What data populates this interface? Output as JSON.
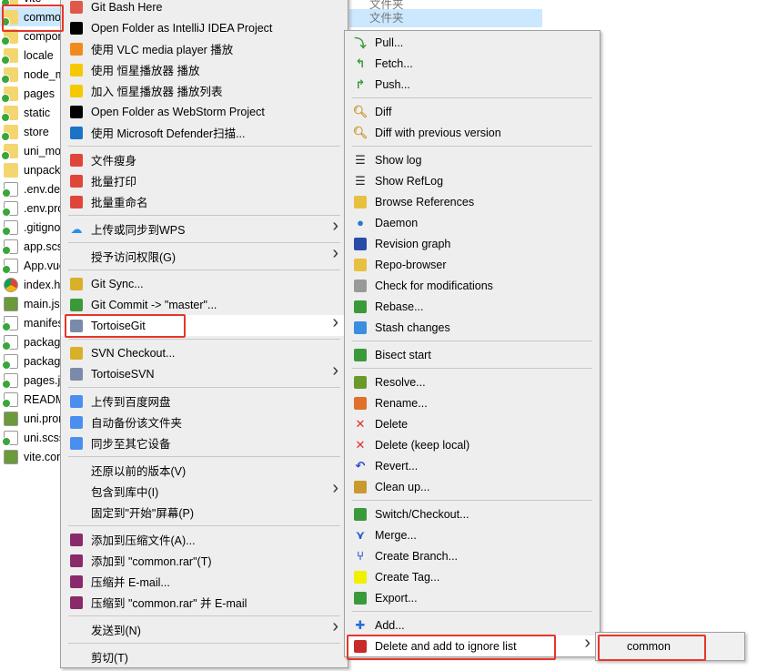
{
  "explorer": {
    "files": [
      {
        "name": "vite",
        "type": "folder"
      },
      {
        "name": "common",
        "type": "folder",
        "selected": true
      },
      {
        "name": "components",
        "type": "folder"
      },
      {
        "name": "locale",
        "type": "folder"
      },
      {
        "name": "node_modules",
        "type": "folder"
      },
      {
        "name": "pages",
        "type": "folder"
      },
      {
        "name": "static",
        "type": "folder"
      },
      {
        "name": "store",
        "type": "folder"
      },
      {
        "name": "uni_modules",
        "type": "folder"
      },
      {
        "name": "unpackage",
        "type": "folder-plain"
      },
      {
        "name": ".env.dev",
        "type": "doc"
      },
      {
        "name": ".env.prod",
        "type": "doc"
      },
      {
        "name": ".gitignore",
        "type": "doc"
      },
      {
        "name": "app.scss",
        "type": "doc"
      },
      {
        "name": "App.vue",
        "type": "doc"
      },
      {
        "name": "index.html",
        "type": "chrome"
      },
      {
        "name": "main.js",
        "type": "script"
      },
      {
        "name": "manifest",
        "type": "doc"
      },
      {
        "name": "package",
        "type": "doc"
      },
      {
        "name": "package",
        "type": "doc"
      },
      {
        "name": "pages.json",
        "type": "doc"
      },
      {
        "name": "README",
        "type": "doc"
      },
      {
        "name": "uni.promise",
        "type": "script"
      },
      {
        "name": "uni.scss",
        "type": "doc"
      },
      {
        "name": "vite.config",
        "type": "script"
      }
    ],
    "type_column": [
      "文件夹",
      "文件夹"
    ]
  },
  "context_menu": [
    {
      "label": "Git Bash Here",
      "icon": "git-bash-icon",
      "color": "#e0584a"
    },
    {
      "label": "Open Folder as IntelliJ IDEA Project",
      "icon": "intellij-icon",
      "color": "#000"
    },
    {
      "label": "使用 VLC media player 播放",
      "icon": "vlc-icon",
      "color": "#f08a1c"
    },
    {
      "label": "使用 恒星播放器 播放",
      "icon": "hengxing-player-icon",
      "color": "#f5c800"
    },
    {
      "label": "加入 恒星播放器 播放列表",
      "icon": "hengxing-player-icon",
      "color": "#f5c800"
    },
    {
      "label": "Open Folder as WebStorm Project",
      "icon": "webstorm-icon",
      "color": "#000"
    },
    {
      "label": "使用 Microsoft Defender扫描...",
      "icon": "defender-shield-icon",
      "color": "#1a73c8"
    },
    {
      "sep": true
    },
    {
      "label": "文件瘦身",
      "icon": "wps-icon",
      "color": "#e0453a"
    },
    {
      "label": "批量打印",
      "icon": "wps-icon",
      "color": "#e0453a"
    },
    {
      "label": "批量重命名",
      "icon": "wps-icon",
      "color": "#e0453a"
    },
    {
      "sep": true
    },
    {
      "label": "上传或同步到WPS",
      "icon": "cloud-icon",
      "color": "#2a8ee6",
      "sub": true
    },
    {
      "sep": true
    },
    {
      "label": "授予访问权限(G)",
      "sub": true
    },
    {
      "sep": true
    },
    {
      "label": "Git Sync...",
      "icon": "git-sync-icon",
      "color": "#d9b028"
    },
    {
      "label": "Git Commit -> \"master\"...",
      "icon": "git-commit-icon",
      "color": "#3a9a3a"
    },
    {
      "label": "TortoiseGit",
      "icon": "tortoisegit-icon",
      "color": "#7a8aa8",
      "sub": true,
      "highlight": true
    },
    {
      "sep": true
    },
    {
      "label": "SVN Checkout...",
      "icon": "svn-checkout-icon",
      "color": "#d9b028"
    },
    {
      "label": "TortoiseSVN",
      "icon": "tortoisesvn-icon",
      "color": "#7a8aa8",
      "sub": true
    },
    {
      "sep": true
    },
    {
      "label": "上传到百度网盘",
      "icon": "baidu-netdisk-icon",
      "color": "#4a8ef0"
    },
    {
      "label": "自动备份该文件夹",
      "icon": "baidu-netdisk-icon",
      "color": "#4a8ef0"
    },
    {
      "label": "同步至其它设备",
      "icon": "baidu-netdisk-icon",
      "color": "#4a8ef0"
    },
    {
      "sep": true
    },
    {
      "label": "还原以前的版本(V)"
    },
    {
      "label": "包含到库中(I)",
      "sub": true
    },
    {
      "label": "固定到\"开始\"屏幕(P)"
    },
    {
      "sep": true
    },
    {
      "label": "添加到压缩文件(A)...",
      "icon": "winrar-icon",
      "color": "#8a2a6a"
    },
    {
      "label": "添加到 \"common.rar\"(T)",
      "icon": "winrar-icon",
      "color": "#8a2a6a"
    },
    {
      "label": "压缩并 E-mail...",
      "icon": "winrar-icon",
      "color": "#8a2a6a"
    },
    {
      "label": "压缩到 \"common.rar\" 并 E-mail",
      "icon": "winrar-icon",
      "color": "#8a2a6a"
    },
    {
      "sep": true
    },
    {
      "label": "发送到(N)",
      "sub": true
    },
    {
      "sep": true
    },
    {
      "label": "剪切(T)"
    }
  ],
  "tortoisegit_menu": [
    {
      "label": "Pull...",
      "icon": "pull-icon",
      "color": "#3a9a3a"
    },
    {
      "label": "Fetch...",
      "icon": "fetch-icon",
      "color": "#3a9a3a"
    },
    {
      "label": "Push...",
      "icon": "push-icon",
      "color": "#3a9a3a"
    },
    {
      "sep": true
    },
    {
      "label": "Diff",
      "icon": "diff-magnifier-icon",
      "color": "#c89a30"
    },
    {
      "label": "Diff with previous version",
      "icon": "diff-magnifier-icon",
      "color": "#c89a30"
    },
    {
      "sep": true
    },
    {
      "label": "Show log",
      "icon": "log-icon",
      "color": "#222"
    },
    {
      "label": "Show RefLog",
      "icon": "reflog-icon",
      "color": "#222"
    },
    {
      "label": "Browse References",
      "icon": "browse-references-icon",
      "color": "#e8c040"
    },
    {
      "label": "Daemon",
      "icon": "globe-icon",
      "color": "#2a7ac8"
    },
    {
      "label": "Revision graph",
      "icon": "revision-graph-icon",
      "color": "#2a4aa8"
    },
    {
      "label": "Repo-browser",
      "icon": "repo-browser-icon",
      "color": "#e8c040"
    },
    {
      "label": "Check for modifications",
      "icon": "check-modifications-icon",
      "color": "#999"
    },
    {
      "label": "Rebase...",
      "icon": "rebase-icon",
      "color": "#3a9a3a"
    },
    {
      "label": "Stash changes",
      "icon": "stash-icon",
      "color": "#3a8ee0"
    },
    {
      "sep": true
    },
    {
      "label": "Bisect start",
      "icon": "bisect-icon",
      "color": "#3a9a3a"
    },
    {
      "sep": true
    },
    {
      "label": "Resolve...",
      "icon": "resolve-icon",
      "color": "#6a9a2a"
    },
    {
      "label": "Rename...",
      "icon": "rename-icon",
      "color": "#e0702a"
    },
    {
      "label": "Delete",
      "icon": "delete-x-icon",
      "color": "#e02a2a"
    },
    {
      "label": "Delete (keep local)",
      "icon": "delete-x-icon",
      "color": "#e02a2a"
    },
    {
      "label": "Revert...",
      "icon": "revert-icon",
      "color": "#2a4ac8"
    },
    {
      "label": "Clean up...",
      "icon": "broom-icon",
      "color": "#c89a30"
    },
    {
      "sep": true
    },
    {
      "label": "Switch/Checkout...",
      "icon": "switch-icon",
      "color": "#3a9a3a"
    },
    {
      "label": "Merge...",
      "icon": "merge-icon",
      "color": "#2a5ac8"
    },
    {
      "label": "Create Branch...",
      "icon": "branch-icon",
      "color": "#2a5ac8"
    },
    {
      "label": "Create Tag...",
      "icon": "tag-icon",
      "color": "#f0f000"
    },
    {
      "label": "Export...",
      "icon": "export-icon",
      "color": "#3a9a3a"
    },
    {
      "sep": true
    },
    {
      "label": "Add...",
      "icon": "add-plus-icon",
      "color": "#2a6ad8"
    },
    {
      "label": "Delete and add to ignore list",
      "icon": "ignore-icon",
      "color": "#c82a2a",
      "sub": true,
      "highlight": true
    }
  ],
  "ignore_submenu": [
    {
      "label": "common"
    }
  ],
  "colors": {
    "highlight_box": "#e8352a",
    "menu_bg": "#eeeeee",
    "selection": "#cce8ff"
  }
}
